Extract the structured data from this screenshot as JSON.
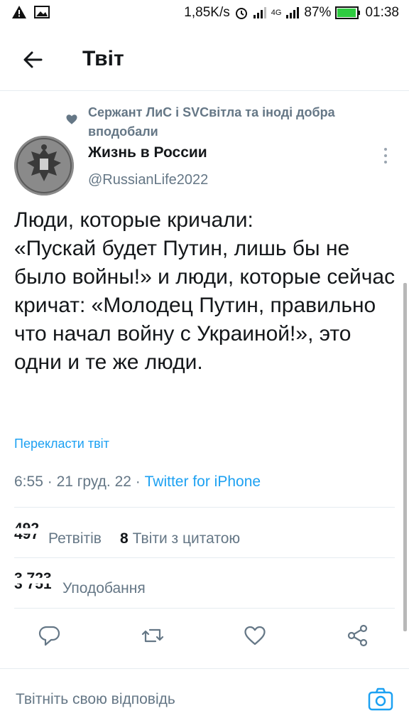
{
  "status_bar": {
    "speed": "1,85K/s",
    "network": "4G",
    "battery": "87%",
    "time": "01:38"
  },
  "header": {
    "title": "Твіт"
  },
  "liked_by": "Сержант ЛиС і SVCвітла та іноді добра вподобали",
  "author": {
    "name": "Жизнь в России",
    "handle": "@RussianLife2022"
  },
  "tweet": {
    "text": "Люди, которые кричали:\n«Пускай будет Путин, лишь бы не было войны!» и люди, которые сейчас кричат: «Молодец Путин, правильно что начал войну с Украиной!», это одни и те же люди.",
    "translate": "Перекласти твіт",
    "time": "6:55",
    "date": "21 груд. 22",
    "source": "Twitter for iPhone",
    "separator": "·"
  },
  "stats": {
    "retweets_old": "497",
    "retweets_new": "492",
    "retweets_label": "Ретвітів",
    "quotes": "8",
    "quotes_label": "Твіти з цитатою",
    "likes_old": "3 751",
    "likes_new": "3 723",
    "likes_label": "Уподобання"
  },
  "actions": [
    "reply-icon",
    "retweet-icon",
    "like-icon",
    "share-icon"
  ],
  "reply": {
    "placeholder": "Твітніть свою відповідь"
  },
  "colors": {
    "accent": "#1da1f2",
    "secondary_text": "#657786",
    "divider": "#e6ecf0"
  }
}
